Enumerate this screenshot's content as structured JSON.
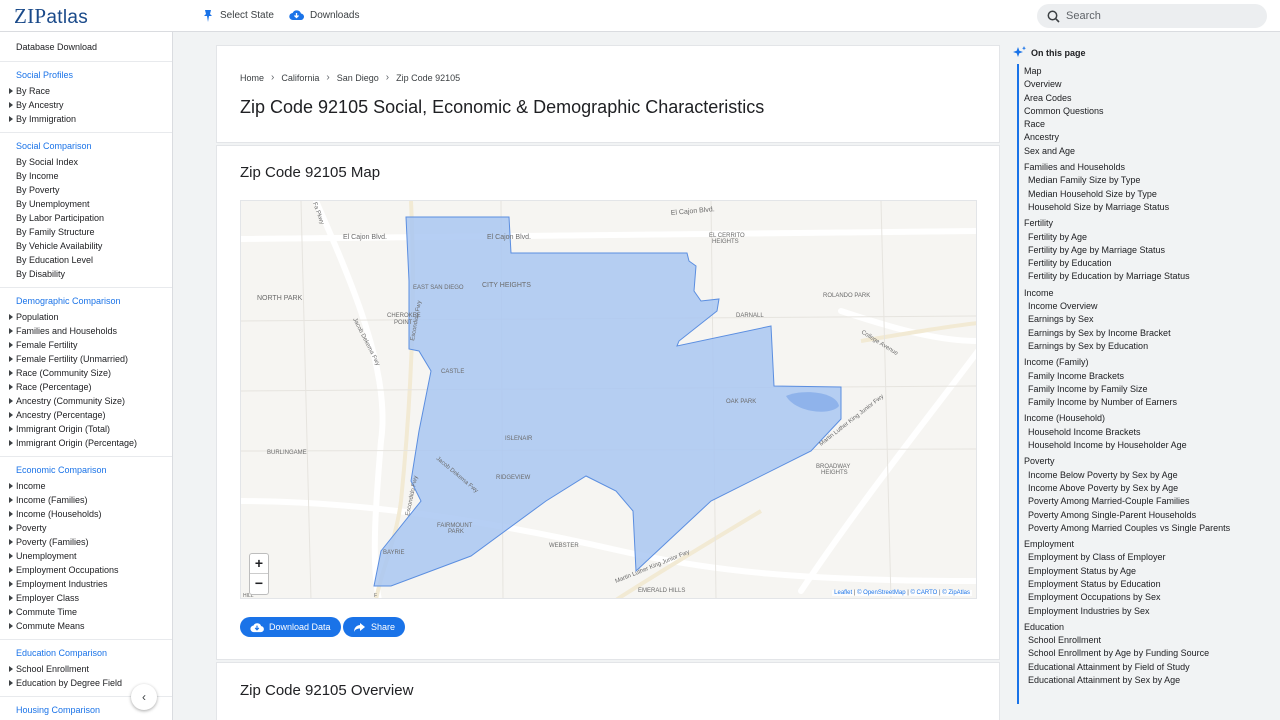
{
  "header": {
    "logo_zip": "ZIP",
    "logo_atlas": "atlas",
    "select_state": "Select State",
    "downloads": "Downloads",
    "search_placeholder": "Search"
  },
  "sidebar": {
    "database_download": "Database Download",
    "sections": [
      {
        "title": "Social Profiles",
        "arrows": true,
        "items": [
          "By Race",
          "By Ancestry",
          "By Immigration"
        ]
      },
      {
        "title": "Social Comparison",
        "arrows": false,
        "items": [
          "By Social Index",
          "By Income",
          "By Poverty",
          "By Unemployment",
          "By Labor Participation",
          "By Family Structure",
          "By Vehicle Availability",
          "By Education Level",
          "By Disability"
        ]
      },
      {
        "title": "Demographic Comparison",
        "arrows": true,
        "items": [
          "Population",
          "Families and Households",
          "Female Fertility",
          "Female Fertility (Unmarried)",
          "Race (Community Size)",
          "Race (Percentage)",
          "Ancestry (Community Size)",
          "Ancestry (Percentage)",
          "Immigrant Origin (Total)",
          "Immigrant Origin (Percentage)"
        ]
      },
      {
        "title": "Economic Comparison",
        "arrows": true,
        "items": [
          "Income",
          "Income (Families)",
          "Income (Households)",
          "Poverty",
          "Poverty (Families)",
          "Unemployment",
          "Employment Occupations",
          "Employment Industries",
          "Employer Class",
          "Commute Time",
          "Commute Means"
        ]
      },
      {
        "title": "Education Comparison",
        "arrows": true,
        "items": [
          "School Enrollment",
          "Education by Degree Field"
        ]
      },
      {
        "title": "Housing Comparison",
        "arrows": false,
        "items": []
      }
    ],
    "collapse_glyph": "‹"
  },
  "main": {
    "breadcrumbs": [
      "Home",
      "California",
      "San Diego",
      "Zip Code 92105"
    ],
    "title": "Zip Code 92105 Social, Economic & Demographic Characteristics",
    "map_section_title": "Zip Code 92105 Map",
    "overview_title": "Zip Code 92105 Overview",
    "download_button": "Download Data",
    "share_button": "Share"
  },
  "map": {
    "labels": {
      "el_cajon_blvd_w": "El Cajon Blvd.",
      "el_cajon_blvd_c": "El Cajon Blvd.",
      "el_cajon_blvd_ne": "El Cajon Blvd.",
      "el_cerrito_heights_1": "EL CERRITO",
      "el_cerrito_heights_2": "HEIGHTS",
      "north_park": "NORTH PARK",
      "east_san_diego": "EAST SAN DIEGO",
      "city_heights": "CITY HEIGHTS",
      "rolando_park": "ROLANDO PARK",
      "cherokee_point_1": "CHEROKEE",
      "cherokee_point_2": "POINT",
      "darnall": "DARNALL",
      "college_avenue": "College Avenue",
      "jacob_dekema_n": "Jacob Dekema Fwy",
      "castle": "CASTLE",
      "oak_park": "OAK PARK",
      "burlingame": "BURLINGAME",
      "islenair": "ISLENAIR",
      "jacob_dekema_s": "Jacob Dekema Fwy",
      "mlk_north": "Martin Luther King Junior Fwy",
      "ridgeview": "RIDGEVIEW",
      "broadway_heights_1": "BROADWAY",
      "broadway_heights_2": "HEIGHTS",
      "fairmount_park_1": "FAIRMOUNT",
      "fairmount_park_2": "PARK",
      "webster": "WEBSTER",
      "bayrie": "BAYRIE",
      "mlk_south": "Martin Luther King Junior Fwy",
      "emerald_hills": "EMERALD HILLS",
      "hill": "HILL",
      "escondido_n": "Escondido Fwy",
      "escondido_s": "Escondido Fwy",
      "fa_pkwy": "Fa Pkwy",
      "fwy_edge": "F"
    },
    "zoom_in": "+",
    "zoom_out": "−",
    "attribution": {
      "leaflet": "Leaflet",
      "osm": "© OpenStreetMap",
      "carto": "© CARTO",
      "zipatlas": "© ZipAtlas",
      "separator": " | "
    },
    "polygon_fill": "#a9c7f2",
    "polygon_stroke": "#5b8ee0"
  },
  "toc": {
    "title": "On this page",
    "items": [
      {
        "label": "Map",
        "sub": false
      },
      {
        "label": "Overview",
        "sub": false
      },
      {
        "label": "Area Codes",
        "sub": false
      },
      {
        "label": "Common Questions",
        "sub": false
      },
      {
        "label": "Race",
        "sub": false
      },
      {
        "label": "Ancestry",
        "sub": false
      },
      {
        "label": "Sex and Age",
        "sub": false
      },
      {
        "label": "Families and Households",
        "sub": false,
        "grp": true
      },
      {
        "label": "Median Family Size by Type",
        "sub": true
      },
      {
        "label": "Median Household Size by Type",
        "sub": true
      },
      {
        "label": "Household Size by Marriage Status",
        "sub": true
      },
      {
        "label": "Fertility",
        "sub": false,
        "grp": true
      },
      {
        "label": "Fertility by Age",
        "sub": true
      },
      {
        "label": "Fertility by Age by Marriage Status",
        "sub": true
      },
      {
        "label": "Fertility by Education",
        "sub": true
      },
      {
        "label": "Fertility by Education by Marriage Status",
        "sub": true
      },
      {
        "label": "Income",
        "sub": false,
        "grp": true
      },
      {
        "label": "Income Overview",
        "sub": true
      },
      {
        "label": "Earnings by Sex",
        "sub": true
      },
      {
        "label": "Earnings by Sex by Income Bracket",
        "sub": true
      },
      {
        "label": "Earnings by Sex by Education",
        "sub": true
      },
      {
        "label": "Income (Family)",
        "sub": false,
        "grp": true
      },
      {
        "label": "Family Income Brackets",
        "sub": true
      },
      {
        "label": "Family Income by Family Size",
        "sub": true
      },
      {
        "label": "Family Income by Number of Earners",
        "sub": true
      },
      {
        "label": "Income (Household)",
        "sub": false,
        "grp": true
      },
      {
        "label": "Household Income Brackets",
        "sub": true
      },
      {
        "label": "Household Income by Householder Age",
        "sub": true
      },
      {
        "label": "Poverty",
        "sub": false,
        "grp": true
      },
      {
        "label": "Income Below Poverty by Sex by Age",
        "sub": true
      },
      {
        "label": "Income Above Poverty by Sex by Age",
        "sub": true
      },
      {
        "label": "Poverty Among Married-Couple Families",
        "sub": true
      },
      {
        "label": "Poverty Among Single-Parent Households",
        "sub": true
      },
      {
        "label": "Poverty Among Married Couples vs Single Parents",
        "sub": true
      },
      {
        "label": "Employment",
        "sub": false,
        "grp": true
      },
      {
        "label": "Employment by Class of Employer",
        "sub": true
      },
      {
        "label": "Employment Status by Age",
        "sub": true
      },
      {
        "label": "Employment Status by Education",
        "sub": true
      },
      {
        "label": "Employment Occupations by Sex",
        "sub": true
      },
      {
        "label": "Employment Industries by Sex",
        "sub": true
      },
      {
        "label": "Education",
        "sub": false,
        "grp": true
      },
      {
        "label": "School Enrollment",
        "sub": true
      },
      {
        "label": "School Enrollment by Age by Funding Source",
        "sub": true
      },
      {
        "label": "Educational Attainment by Field of Study",
        "sub": true
      },
      {
        "label": "Educational Attainment by Sex by Age",
        "sub": true
      }
    ]
  },
  "colors": {
    "accent": "#1a73e8",
    "logo": "#1a4a8a"
  }
}
